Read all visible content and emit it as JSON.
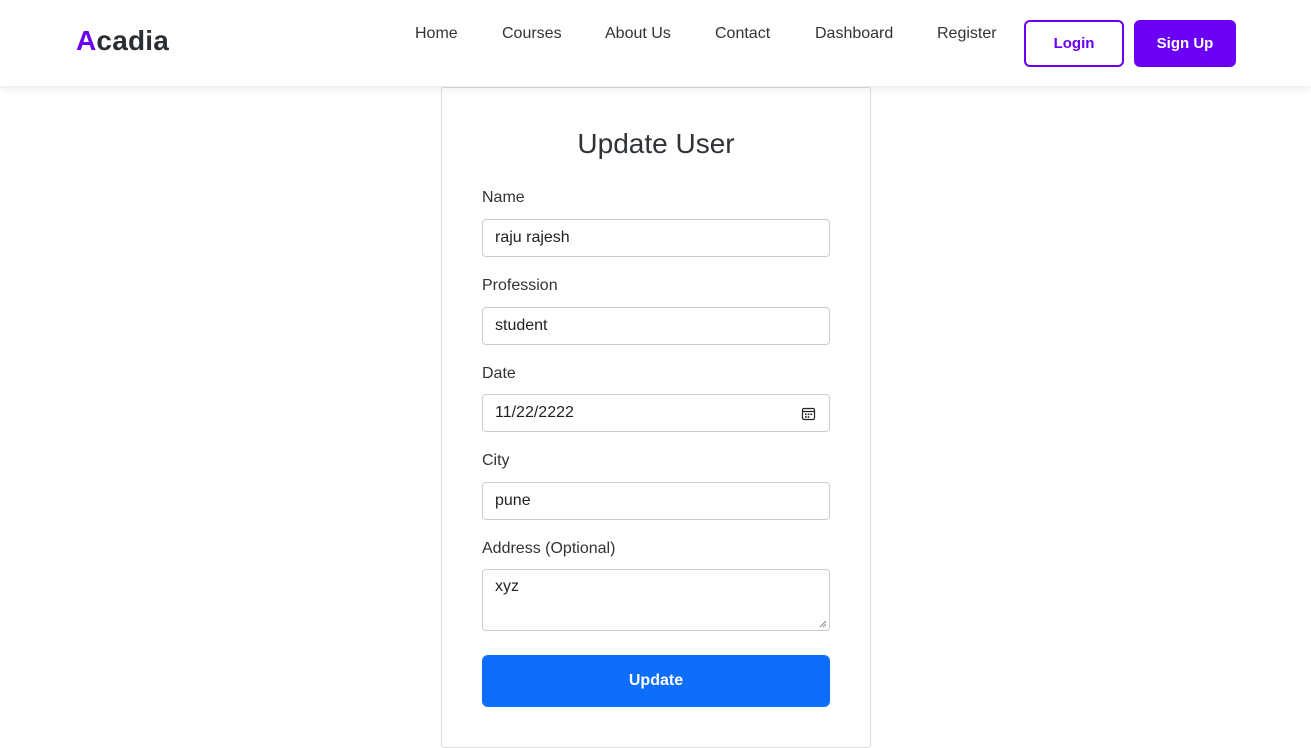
{
  "brand": {
    "initial": "A",
    "rest": "cadia"
  },
  "nav": {
    "links": [
      {
        "label": "Home"
      },
      {
        "label": "Courses"
      },
      {
        "label": "About Us"
      },
      {
        "label": "Contact"
      },
      {
        "label": "Dashboard"
      },
      {
        "label": "Register"
      }
    ],
    "login_label": "Login",
    "signup_label": "Sign Up"
  },
  "form": {
    "title": "Update User",
    "name_label": "Name",
    "name_value": "raju rajesh",
    "profession_label": "Profession",
    "profession_value": "student",
    "date_label": "Date",
    "date_value": "11/22/2222",
    "city_label": "City",
    "city_value": "pune",
    "address_label": "Address (Optional)",
    "address_value": "xyz",
    "submit_label": "Update"
  },
  "icons": {
    "date_picker": "calendar-icon",
    "textarea_resize": "resize-grip-icon"
  },
  "colors": {
    "brand_accent": "#6a00f4",
    "primary_button": "#0d6efd",
    "text": "#333333"
  }
}
